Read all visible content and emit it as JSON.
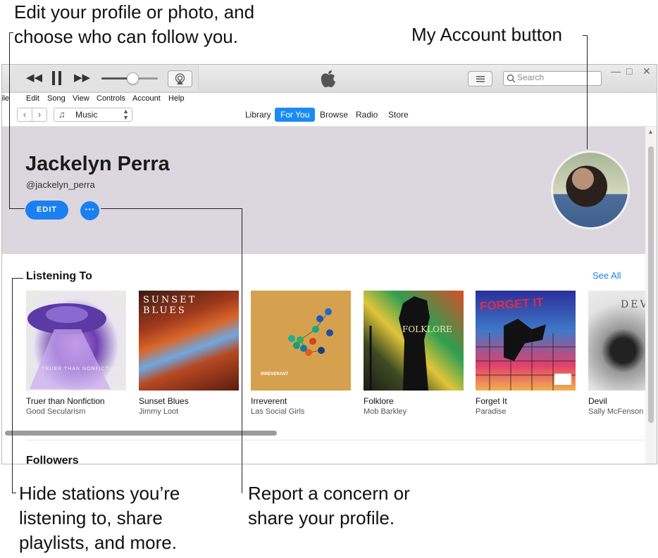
{
  "callouts": {
    "edit_profile": [
      "Edit your profile or photo, and",
      "choose who can follow you."
    ],
    "my_account": "My Account button",
    "hide_stations": [
      "Hide stations you’re",
      "listening to, share",
      "playlists, and more."
    ],
    "report": [
      "Report a concern or",
      "share your profile."
    ]
  },
  "toolbar": {
    "search_placeholder": "Search",
    "volume_level": 0.55
  },
  "menu": [
    "ile",
    "Edit",
    "Song",
    "View",
    "Controls",
    "Account",
    "Help"
  ],
  "nav": {
    "media_kind": "Music",
    "tabs": [
      {
        "label": "Library",
        "active": false
      },
      {
        "label": "For You",
        "active": true
      },
      {
        "label": "Browse",
        "active": false
      },
      {
        "label": "Radio",
        "active": false
      },
      {
        "label": "Store",
        "active": false
      }
    ]
  },
  "profile": {
    "name": "Jackelyn Perra",
    "handle": "@jackelyn_perra",
    "edit_label": "EDIT",
    "more_label": "···"
  },
  "listening": {
    "title": "Listening To",
    "see_all": "See All",
    "albums": [
      {
        "title": "Truer than Nonfiction",
        "artist": "Good Secularism",
        "art_text": "TRUER THAN NONFICTION"
      },
      {
        "title": "Sunset Blues",
        "artist": "Jimmy Loot",
        "art_text": "SUNSET BLUES"
      },
      {
        "title": "Irreverent",
        "artist": "Las Social Girls",
        "art_text": "IRREVERANT"
      },
      {
        "title": "Folklore",
        "artist": "Mob Barkley",
        "art_text": "FOLKLORE"
      },
      {
        "title": "Forget It",
        "artist": "Paradise",
        "art_text": "FORGET IT"
      },
      {
        "title": "Devil",
        "artist": "Sally McFenson",
        "art_text": "DEVIL"
      }
    ]
  },
  "followers": {
    "title": "Followers"
  },
  "colors": {
    "accent": "#1a7ff0",
    "header_bg": "#dcd7de"
  }
}
